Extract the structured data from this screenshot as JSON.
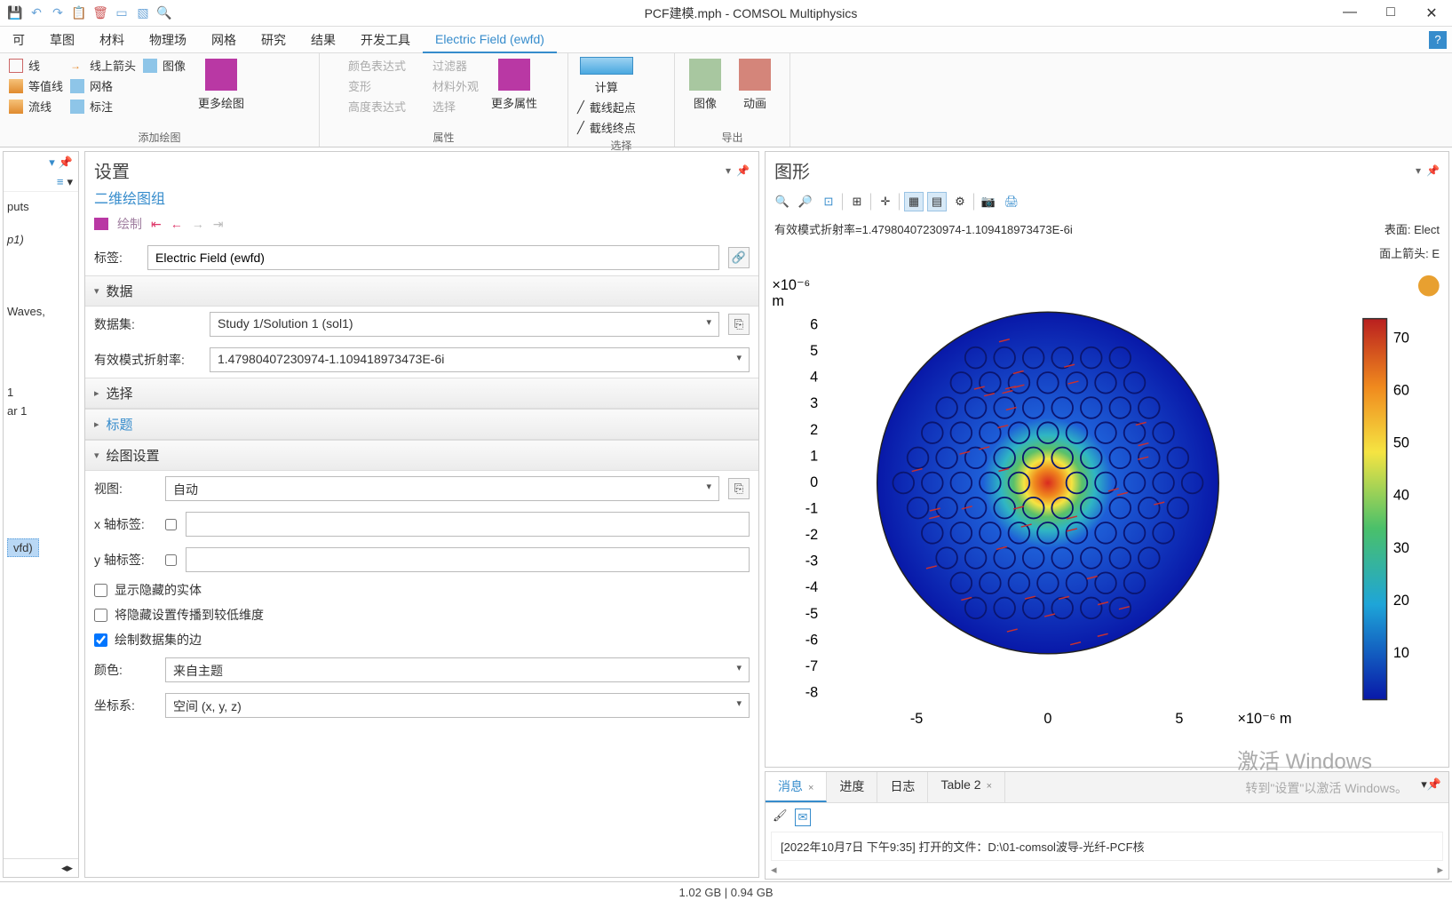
{
  "window": {
    "title": "PCF建模.mph - COMSOL Multiphysics",
    "min": "—",
    "max": "□",
    "close": "✕"
  },
  "menu": {
    "tabs": [
      "可",
      "草图",
      "材料",
      "物理场",
      "网格",
      "研究",
      "结果",
      "开发工具"
    ],
    "activeTab": "Electric Field (ewfd)",
    "help": "?"
  },
  "ribbon": {
    "addGroup": "添加绘图",
    "plotItems": {
      "line": "线",
      "lineArrow": "线上箭头",
      "image": "图像",
      "contour": "等值线",
      "mesh": "网格",
      "streamline": "流线",
      "annotation": "标注"
    },
    "morePlots": "更多绘图",
    "attrGroup": "属性",
    "attrItems": {
      "colorExpr": "颜色表达式",
      "filter": "过滤器",
      "deform": "变形",
      "matAppear": "材料外观",
      "heightExpr": "高度表达式",
      "select": "选择"
    },
    "moreAttrs": "更多属性",
    "selectGroup": "选择",
    "compute": "计算",
    "cutStart": "截线起点",
    "cutEnd": "截线终点",
    "exportGroup": "导出",
    "img": "图像",
    "anim": "动画"
  },
  "settingsPanel": {
    "title": "设置",
    "subtitle": "二维绘图组",
    "drawBtn": "绘制",
    "tagLabel": "标签:",
    "tagValue": "Electric Field (ewfd)",
    "secData": "数据",
    "dataset": "数据集:",
    "datasetVal": "Study 1/Solution 1 (sol1)",
    "effIndex": "有效模式折射率:",
    "effIndexVal": "1.47980407230974-1.109418973473E-6i",
    "secSelect": "选择",
    "secTitle": "标题",
    "secPlotSettings": "绘图设置",
    "view": "视图:",
    "viewVal": "自动",
    "xaxis": "x 轴标签:",
    "yaxis": "y 轴标签:",
    "showHidden": "显示隐藏的实体",
    "propHidden": "将隐藏设置传播到较低维度",
    "plotEdges": "绘制数据集的边",
    "color": "颜色:",
    "colorVal": "来自主题",
    "coord": "坐标系:",
    "coordVal": "空间  (x, y, z)"
  },
  "graphics": {
    "title": "图形",
    "effLabel": "有效模式折射率=1.47980407230974-1.109418973473E-6i",
    "surface": "表面: Elect",
    "arrows": "面上箭头: E",
    "yunit": "×10⁻⁶\nm",
    "xunit": "×10⁻⁶  m",
    "colorbar": [
      70,
      60,
      50,
      40,
      30,
      20,
      10
    ],
    "yticks": [
      6,
      5,
      4,
      3,
      2,
      1,
      0,
      -1,
      -2,
      -3,
      -4,
      -5,
      -6,
      -7,
      -8
    ],
    "xticks": [
      -5,
      0,
      5
    ]
  },
  "messages": {
    "tabs": {
      "msg": "消息",
      "progress": "进度",
      "log": "日志",
      "table": "Table 2"
    },
    "entry": "[2022年10月7日 下午9:35] 打开的文件：D:\\01-comsol波导-光纤-PCF核"
  },
  "watermark": {
    "l1": "激活 Windows",
    "l2": "转到\"设置\"以激活 Windows。"
  },
  "status": "1.02 GB | 0.94 GB",
  "tree": {
    "a": "puts",
    "b": "p1)",
    "c": "Waves,",
    "d": "1",
    "e": "ar 1",
    "f": "vfd)"
  },
  "chart_data": {
    "type": "heatmap",
    "title": "Electric Field (ewfd)",
    "xlabel": "×10⁻⁶ m",
    "ylabel": "×10⁻⁶ m",
    "xlim": [
      -8,
      8
    ],
    "ylim": [
      -8,
      7
    ],
    "colorbar_range": [
      5,
      75
    ],
    "description": "Circular fiber cross-section with photonic-crystal hole lattice; field peak at center (hot spot ~75), decaying to ~5 at radius 6.5e-6; red arrow surface overlay for E-field direction",
    "geometry": {
      "fiber_radius": 6.5,
      "hole_radius": 0.45,
      "lattice_pitch": 1.3,
      "rings": 5,
      "core_defect": true
    }
  }
}
